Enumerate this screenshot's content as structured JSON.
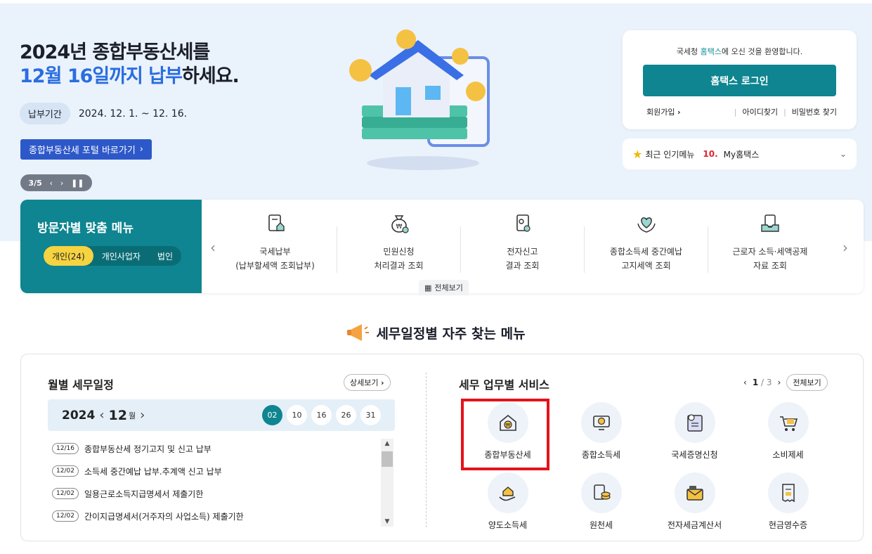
{
  "hero": {
    "title_line1": "2024년 종합부동산세를",
    "title_line2_blue1": "12월 16일까지 납부",
    "title_line2_rest": "하세요.",
    "period_label": "납부기간",
    "period_value": "2024. 12. 1. ~ 12. 16.",
    "portal_button": "종합부동산세 포털 바로가기",
    "slide_counter": "3/5"
  },
  "login": {
    "welcome_prefix": "국세청 ",
    "welcome_brand": "홈택스",
    "welcome_suffix": "에 오신 것을 환영합니다.",
    "login_button": "홈택스 로그인",
    "signup": "회원가입",
    "find_id": "아이디찾기",
    "find_pw": "비밀번호 찾기"
  },
  "popular": {
    "label": "최근 인기메뉴",
    "rank": "10.",
    "item": "My홈택스"
  },
  "visitor": {
    "title": "방문자별 맞춤 메뉴",
    "tabs": [
      "개인(24)",
      "개인사업자",
      "법인"
    ],
    "items": [
      {
        "line1": "국세납부",
        "line2": "(납부할세액 조회납부)",
        "icon": "tax-payment-icon"
      },
      {
        "line1": "민원신청",
        "line2": "처리결과 조회",
        "icon": "money-bag-icon"
      },
      {
        "line1": "전자신고",
        "line2": "결과 조회",
        "icon": "e-filing-icon"
      },
      {
        "line1": "종합소득세 중간예납",
        "line2": "고지세액 조회",
        "icon": "heart-hands-icon"
      },
      {
        "line1": "근로자 소득·세액공제",
        "line2": "자료 조회",
        "icon": "document-tray-icon"
      }
    ],
    "view_all": "전체보기"
  },
  "section_title": "세무일정별 자주 찾는 메뉴",
  "schedule": {
    "title": "월별 세무일정",
    "detail_button": "상세보기",
    "year": "2024",
    "month": "12",
    "month_suffix": "월",
    "days": [
      "02",
      "10",
      "16",
      "26",
      "31"
    ],
    "items": [
      {
        "date": "12/16",
        "text": "종합부동산세 정기고지 및 신고 납부"
      },
      {
        "date": "12/02",
        "text": "소득세 중간예납 납부.추계액 신고 납부"
      },
      {
        "date": "12/02",
        "text": "일용근로소득지급명세서 제출기한"
      },
      {
        "date": "12/02",
        "text": "간이지급명세서(거주자의 사업소득) 제출기한"
      }
    ]
  },
  "services": {
    "title": "세무 업무별 서비스",
    "page_current": "1",
    "page_total": "/ 3",
    "view_all": "전체보기",
    "items": [
      {
        "label": "종합부동산세",
        "icon": "house-won-icon"
      },
      {
        "label": "종합소득세",
        "icon": "monitor-won-icon"
      },
      {
        "label": "국세증명신청",
        "icon": "certificate-icon"
      },
      {
        "label": "소비제세",
        "icon": "shopping-cart-icon"
      },
      {
        "label": "양도소득세",
        "icon": "house-hand-icon"
      },
      {
        "label": "원천세",
        "icon": "coins-document-icon"
      },
      {
        "label": "전자세금계산서",
        "icon": "tax-envelope-icon"
      },
      {
        "label": "현금영수증",
        "icon": "receipt-icon"
      }
    ]
  },
  "colors": {
    "teal": "#0e8590",
    "blue": "#2a6de0",
    "highlight": "#e3121b",
    "tab_active": "#f5d341"
  }
}
